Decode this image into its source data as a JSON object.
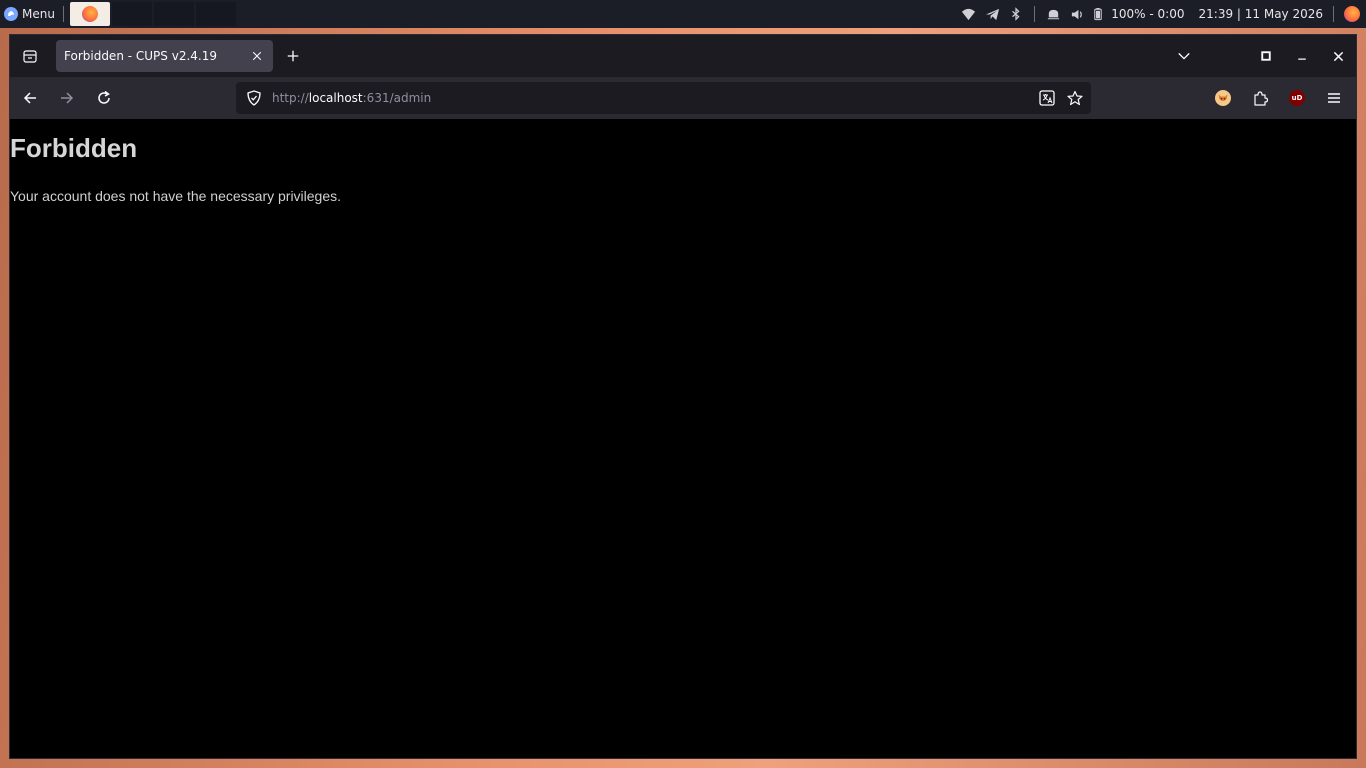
{
  "panel": {
    "menu_label": "Menu",
    "battery_text": "100% - 0:00",
    "clock_text": "21:39 | 11 May 2026",
    "tray_icons": [
      "wifi-icon",
      "telegram-icon",
      "bluetooth-icon",
      "notification-icon",
      "volume-icon",
      "battery-icon",
      "firefox-icon"
    ]
  },
  "browser": {
    "tab": {
      "title": "Forbidden - CUPS v2.4.19"
    },
    "url": {
      "scheme": "http://",
      "host": "localhost",
      "rest": ":631/admin"
    },
    "extensions": {
      "ublock_label": "uD"
    }
  },
  "page": {
    "heading": "Forbidden",
    "message": "Your account does not have the necessary privileges."
  },
  "colors": {
    "page_background": "#000000",
    "heading_color": "#d6d6d6",
    "toolbar_background": "#2b2a33",
    "tab_background": "#42414d"
  }
}
